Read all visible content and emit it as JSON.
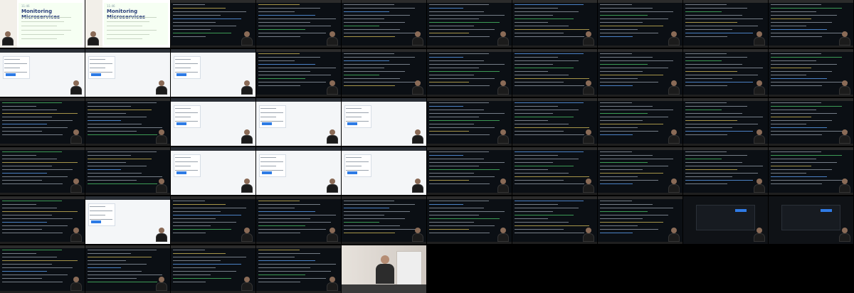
{
  "top_slide_tiles": [
    {
      "label": "11:46",
      "title": "Monitoring Microservices"
    },
    {
      "label": "11:46",
      "title": "Monitoring Microservices"
    }
  ],
  "tile_kinds": [
    "slide",
    "slide",
    "terminal",
    "terminal",
    "terminal",
    "terminal",
    "terminal",
    "terminal",
    "terminal",
    "terminal",
    "browser",
    "browser",
    "browser",
    "terminal",
    "terminal",
    "terminal",
    "terminal",
    "terminal",
    "terminal",
    "terminal",
    "terminal",
    "terminal",
    "browser",
    "browser",
    "browser",
    "terminal",
    "terminal",
    "terminal",
    "terminal",
    "terminal",
    "terminal",
    "terminal",
    "browser",
    "browser",
    "browser",
    "terminal",
    "terminal",
    "terminal",
    "terminal",
    "terminal",
    "terminal",
    "browser",
    "terminal",
    "terminal",
    "terminal",
    "terminal",
    "terminal",
    "terminal",
    "dash",
    "dash",
    "terminal",
    "terminal",
    "terminal",
    "terminal",
    "cam"
  ],
  "colors": {
    "terminal_bg": "#0b0f14",
    "terminal_text": "#9aa3ad",
    "terminal_green": "#4ec96b",
    "terminal_yellow": "#d9c25b",
    "terminal_blue": "#62a8ff"
  }
}
